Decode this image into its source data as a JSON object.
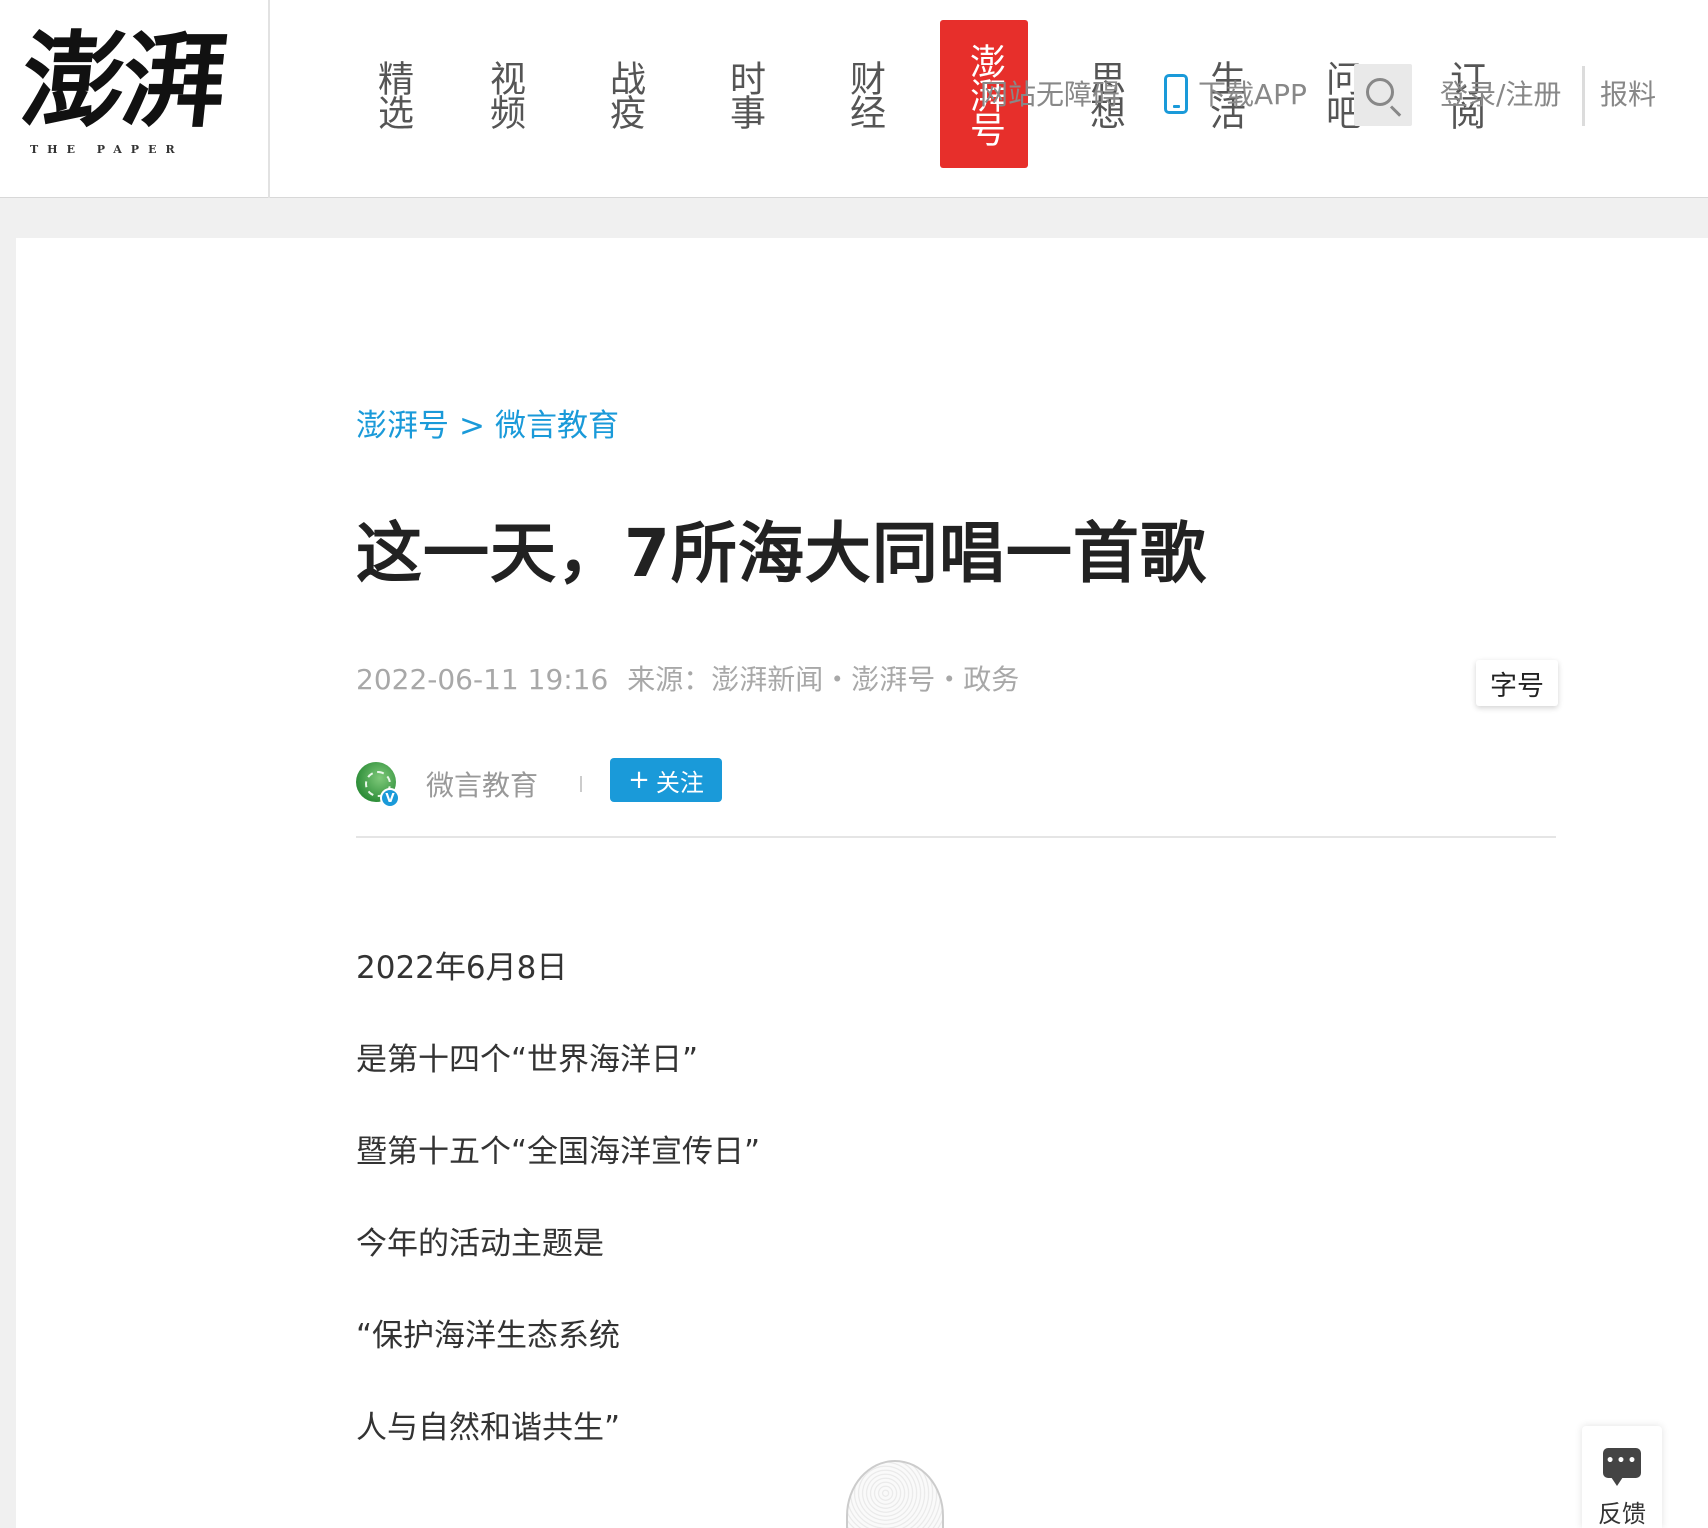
{
  "logo": {
    "main": "澎湃",
    "sub": "THE PAPER"
  },
  "nav": [
    {
      "label": "精选",
      "active": false
    },
    {
      "label": "视频",
      "active": false
    },
    {
      "label": "战疫",
      "active": false
    },
    {
      "label": "时事",
      "active": false
    },
    {
      "label": "财经",
      "active": false
    },
    {
      "label": "澎湃号",
      "active": true
    },
    {
      "label": "思想",
      "active": false
    },
    {
      "label": "生活",
      "active": false
    },
    {
      "label": "问吧",
      "active": false
    },
    {
      "label": "订阅",
      "active": false
    }
  ],
  "toolbar": {
    "accessibility": "网站无障碍",
    "download_app": "下载APP",
    "login": "登录/注册",
    "report": "报料"
  },
  "breadcrumb": [
    "澎湃号",
    ">",
    "微言教育"
  ],
  "article": {
    "title": "这一天，7所海大同唱一首歌",
    "datetime": "2022-06-11 19:16",
    "source_label": "来源：",
    "source": "澎湃新闻・澎湃号・政务",
    "font_size_button": "字号",
    "author": {
      "name": "微言教育",
      "verified_badge": "V",
      "follow_label": "关注",
      "follow_icon": "plus-icon"
    },
    "paragraphs": [
      "2022年6月8日",
      "是第十四个“世界海洋日”",
      "暨第十五个“全国海洋宣传日”",
      "今年的活动主题是",
      "“保护海洋生态系统",
      "人与自然和谐共生”"
    ]
  },
  "feedback": {
    "label": "反馈",
    "icon": "chat-bubble-icon"
  },
  "colors": {
    "accent_blue": "#1a9ad9",
    "brand_red": "#e72f2b"
  }
}
